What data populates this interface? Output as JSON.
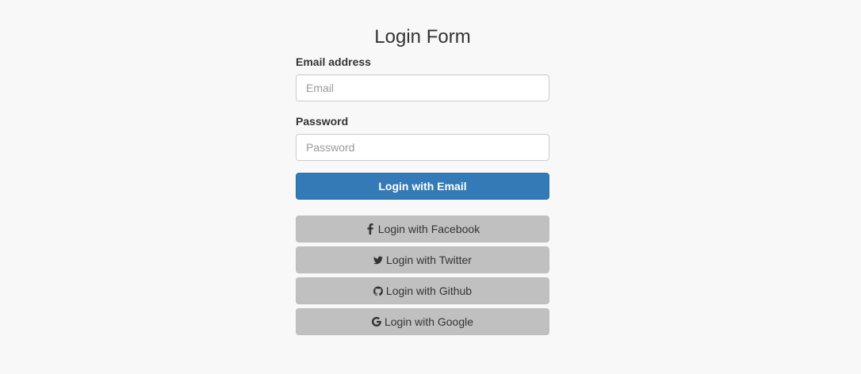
{
  "form": {
    "title": "Login Form",
    "email_label": "Email address",
    "email_placeholder": "Email",
    "email_value": "",
    "password_label": "Password",
    "password_placeholder": "Password",
    "password_value": "",
    "submit_label": "Login with Email"
  },
  "social": {
    "facebook_label": "Login with Facebook",
    "twitter_label": "Login with Twitter",
    "github_label": "Login with Github",
    "google_label": "Login with Google"
  },
  "icons": {
    "facebook": "facebook-icon",
    "twitter": "twitter-icon",
    "github": "github-icon",
    "google": "google-icon"
  },
  "colors": {
    "background": "#f8f8f8",
    "primary": "#337ab7",
    "social_button": "#c0c0c0",
    "text": "#333333"
  }
}
